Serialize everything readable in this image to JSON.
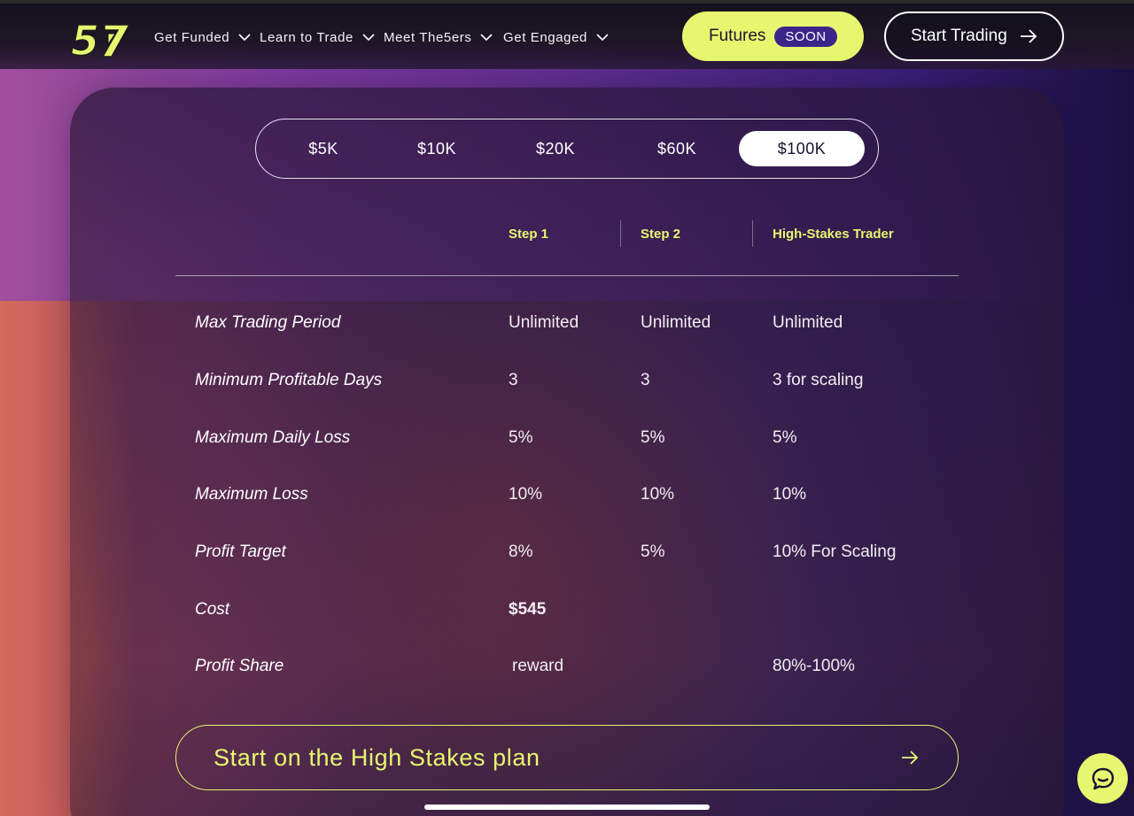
{
  "nav": {
    "items": [
      {
        "label": "Get Funded"
      },
      {
        "label": "Learn to Trade"
      },
      {
        "label": "Meet The5ers"
      },
      {
        "label": "Get Engaged"
      }
    ],
    "futures_label": "Futures",
    "soon_badge": "SOON",
    "start_trading_label": "Start Trading"
  },
  "plan_selector": {
    "options": [
      "$5K",
      "$10K",
      "$20K",
      "$60K",
      "$100K"
    ],
    "selected": "$100K"
  },
  "table": {
    "columns": [
      "Step 1",
      "Step 2",
      "High-Stakes Trader"
    ],
    "rows": [
      {
        "label": "Max Trading Period",
        "values": [
          "Unlimited",
          "Unlimited",
          "Unlimited"
        ]
      },
      {
        "label": "Minimum Profitable Days",
        "values": [
          "3",
          "3",
          "3 for scaling"
        ]
      },
      {
        "label": "Maximum Daily Loss",
        "values": [
          "5%",
          "5%",
          "5%"
        ]
      },
      {
        "label": "Maximum Loss",
        "values": [
          "10%",
          "10%",
          "10%"
        ]
      },
      {
        "label": "Profit Target",
        "values": [
          "8%",
          "5%",
          "10% For Scaling"
        ]
      },
      {
        "label": "Cost",
        "values": [
          "$545",
          "",
          ""
        ]
      },
      {
        "label": "Profit Share",
        "values": [
          "reward",
          "",
          "80%-100%"
        ]
      }
    ]
  },
  "cta_label": "Start on the High Stakes plan",
  "colors": {
    "accent": "#e6f76f",
    "badge": "#3a258a"
  },
  "icons": {
    "logo": "the5ers-logo",
    "chevron": "chevron-down-icon",
    "arrow": "arrow-right-icon",
    "chat": "chat-bubble-icon"
  }
}
